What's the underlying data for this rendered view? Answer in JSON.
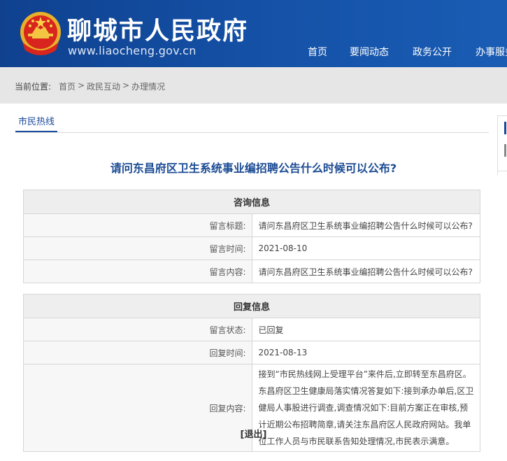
{
  "header": {
    "site_title": "聊城市人民政府",
    "site_url": "www.liaocheng.gov.cn",
    "nav": [
      "首页",
      "要闻动态",
      "政务公开",
      "办事服务"
    ],
    "brand_color": "#144aa0"
  },
  "breadcrumb": {
    "label": "当前位置:",
    "items": [
      "首页",
      "政民互动",
      "办理情况"
    ],
    "separator": ">"
  },
  "tab": {
    "label": "市民热线"
  },
  "page_title": "请问东昌府区卫生系统事业编招聘公告什么时候可以公布?",
  "consult": {
    "heading": "咨询信息",
    "rows": [
      {
        "label": "留言标题:",
        "value": "请问东昌府区卫生系统事业编招聘公告什么时候可以公布?"
      },
      {
        "label": "留言时间:",
        "value": "2021-08-10"
      },
      {
        "label": "留言内容:",
        "value": "请问东昌府区卫生系统事业编招聘公告什么时候可以公布?"
      }
    ]
  },
  "reply": {
    "heading": "回复信息",
    "rows": [
      {
        "label": "留言状态:",
        "value": "已回复"
      },
      {
        "label": "回复时间:",
        "value": "2021-08-13"
      },
      {
        "label": "回复内容:",
        "value": "接到“市民热线网上受理平台”来件后,立即转至东昌府区。东昌府区卫生健康局落实情况答复如下:接到承办单后,区卫健局人事股进行调查,调查情况如下:目前方案正在审核,预计近期公布招聘简章,请关注东昌府区人民政府网站。我单位工作人员与市民联系告知处理情况,市民表示满意。"
      }
    ]
  },
  "exit_label": "[退出]"
}
